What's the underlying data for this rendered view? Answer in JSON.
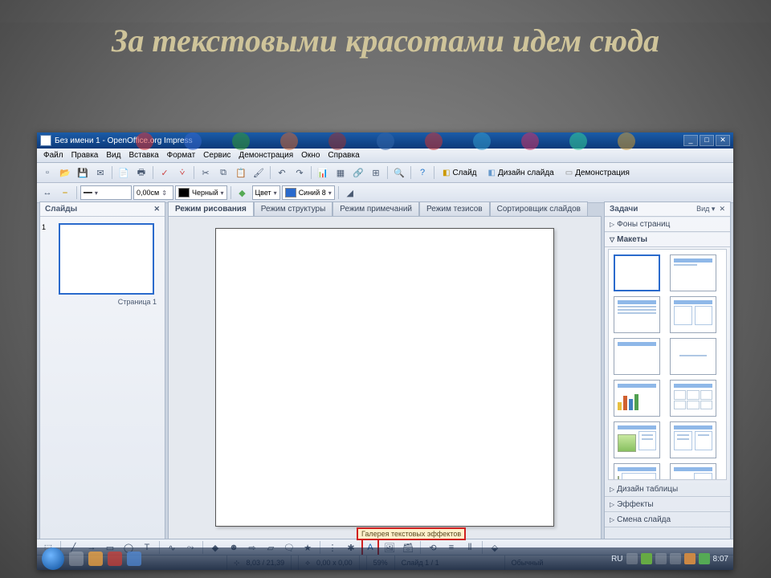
{
  "slide_title": "За текстовыми красотами идем сюда",
  "window": {
    "title": "Без имени 1 - OpenOffice.org Impress",
    "min": "_",
    "max": "□",
    "close": "✕"
  },
  "menu": [
    "Файл",
    "Правка",
    "Вид",
    "Вставка",
    "Формат",
    "Сервис",
    "Демонстрация",
    "Окно",
    "Справка"
  ],
  "toolbar2": {
    "size_val": "0,00см",
    "color1": "Черный",
    "fill_label": "Цвет",
    "color2": "Синий 8"
  },
  "right_buttons": {
    "slide": "Слайд",
    "design": "Дизайн слайда",
    "demo": "Демонстрация"
  },
  "slides_panel": {
    "title": "Слайды",
    "page": "Страница 1",
    "num": "1"
  },
  "tabs": [
    "Режим рисования",
    "Режим структуры",
    "Режим примечаний",
    "Режим тезисов",
    "Сортировщик слайдов"
  ],
  "tasks": {
    "title": "Задачи",
    "view": "Вид",
    "sections": {
      "bg": "Фоны страниц",
      "layouts": "Макеты",
      "table": "Дизайн таблицы",
      "effects": "Эффекты",
      "transition": "Смена слайда"
    }
  },
  "callout_text": "Галерея текстовых эффектов",
  "status": {
    "pos": "8,03 / 21,39",
    "size": "0,00 x 0,00",
    "zoom": "59%",
    "slide": "Слайд 1 / 1",
    "mode": "Обычный"
  },
  "tray": {
    "lang": "RU",
    "time": "8:07"
  }
}
